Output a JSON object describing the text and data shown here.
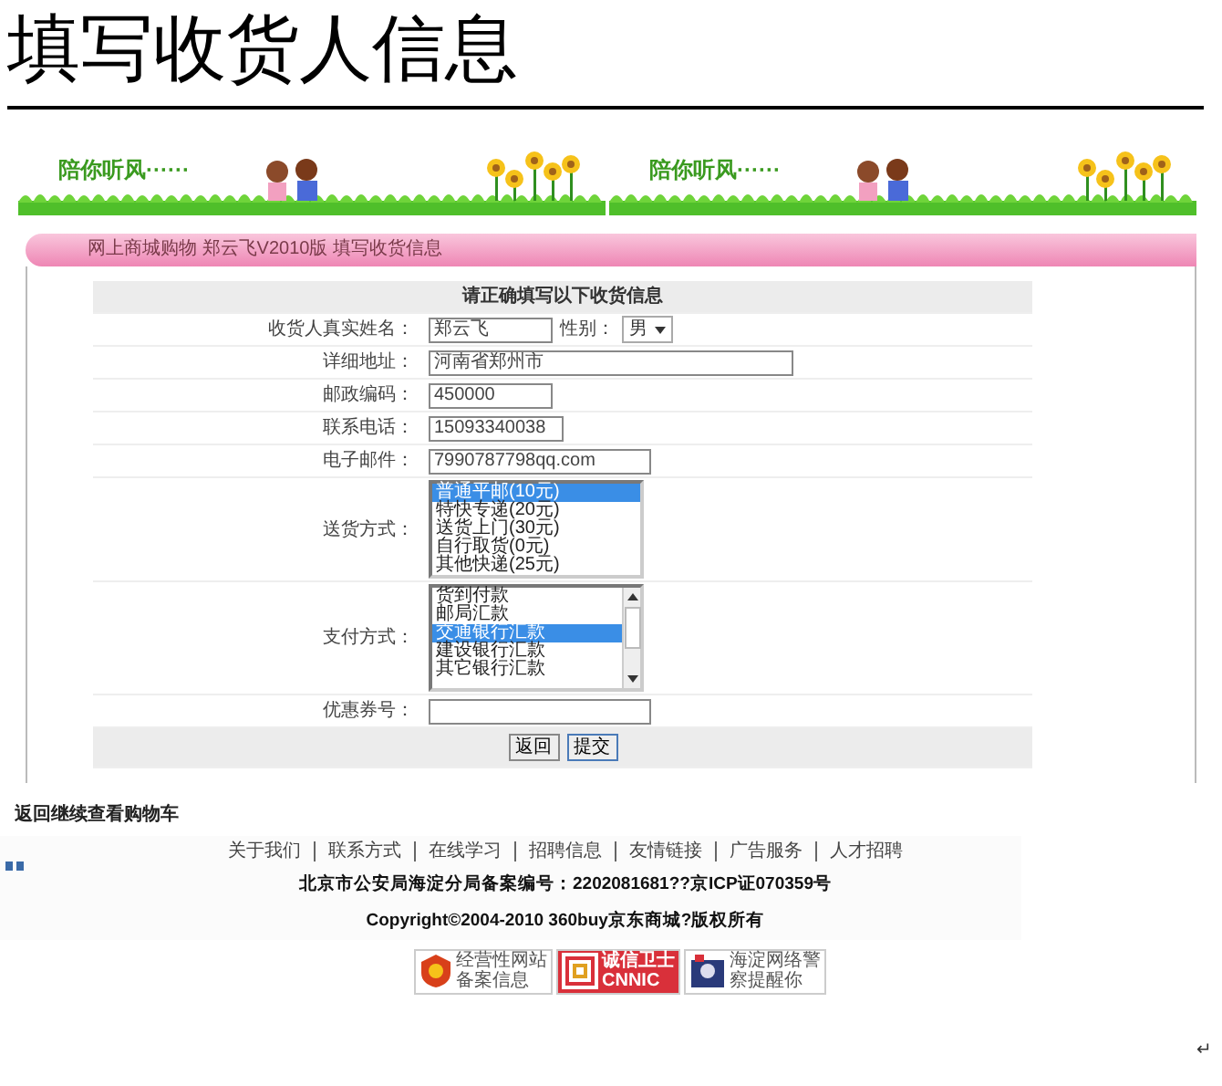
{
  "title": "填写收货人信息",
  "banner": {
    "slogans": [
      "陪你听风······",
      "陪你听风······"
    ]
  },
  "breadcrumb": "网上商城购物  郑云飞V2010版  填写收货信息",
  "form": {
    "heading": "请正确填写以下收货信息",
    "fields": [
      {
        "kind": "text",
        "label": "收货人真实姓名：",
        "value": "郑云飞",
        "extra": {
          "label": "性别：",
          "value": "男"
        }
      },
      {
        "kind": "text",
        "label": "详细地址：",
        "value": "河南省郑州市"
      },
      {
        "kind": "text",
        "label": "邮政编码：",
        "value": "450000"
      },
      {
        "kind": "text",
        "label": "联系电话：",
        "value": "15093340038"
      },
      {
        "kind": "text",
        "label": "电子邮件：",
        "value": "7990787798qq.com"
      },
      {
        "kind": "list",
        "label": "送货方式：",
        "options": [
          {
            "text": "普通平邮(10元)",
            "selected": true
          },
          {
            "text": "特快专递(20元)",
            "selected": false
          },
          {
            "text": "送货上门(30元)",
            "selected": false
          },
          {
            "text": "自行取货(0元)",
            "selected": false
          },
          {
            "text": "其他快递(25元)",
            "selected": false
          }
        ]
      },
      {
        "kind": "scroll_list",
        "label": "支付方式：",
        "options": [
          {
            "text": "货到付款",
            "selected": false
          },
          {
            "text": "邮局汇款",
            "selected": false
          },
          {
            "text": "交通银行汇款",
            "selected": true
          },
          {
            "text": "建设银行汇款",
            "selected": false
          },
          {
            "text": "其它银行汇款",
            "selected": false
          }
        ]
      },
      {
        "kind": "text",
        "label": "优惠券号："
      }
    ],
    "buttons": [
      "返回",
      "提交"
    ]
  },
  "back_link": "返回继续查看购物车",
  "footer": {
    "links": [
      "关于我们",
      "联系方式",
      "在线学习",
      "招聘信息",
      "友情链接",
      "广告服务",
      "人才招聘"
    ],
    "record": "北京市公安局海淀分局备案编号：2202081681??京ICP证070359号",
    "copyright": "Copyright©2004-2010  360buy京东商城?版权所有",
    "badges": [
      {
        "kind": "record",
        "lines": [
          "经营性网站",
          "备案信息"
        ]
      },
      {
        "kind": "trust",
        "lines": [
          "诚信卫士",
          "CNNIC"
        ]
      },
      {
        "kind": "police",
        "lines": [
          "海淀网络警",
          "察提醒你"
        ]
      }
    ]
  },
  "paragraph_mark": "↵"
}
